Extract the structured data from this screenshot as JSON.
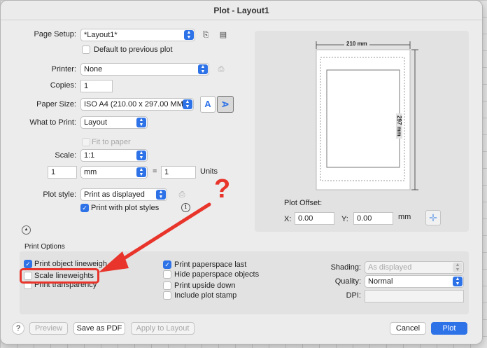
{
  "window": {
    "title": "Plot - Layout1"
  },
  "page_setup": {
    "label": "Page Setup:",
    "value": "*Layout1*",
    "default_checkbox_label": "Default to previous plot",
    "default_checked": false
  },
  "printer": {
    "label": "Printer:",
    "value": "None"
  },
  "copies": {
    "label": "Copies:",
    "value": "1"
  },
  "paper_size": {
    "label": "Paper Size:",
    "value": "ISO A4 (210.00 x 297.00 MM)",
    "portrait_glyph": "A",
    "landscape_glyph": "A"
  },
  "what_to_print": {
    "label": "What to Print:",
    "value": "Layout"
  },
  "fit_to_paper": {
    "label": "Fit to paper",
    "checked": false,
    "enabled": false
  },
  "scale": {
    "label": "Scale:",
    "value": "1:1"
  },
  "units_row": {
    "left": "1",
    "unit": "mm",
    "equals": "=",
    "right": "1",
    "units_label": "Units"
  },
  "plot_style": {
    "label": "Plot style:",
    "value": "Print as displayed",
    "with_styles_label": "Print with plot styles",
    "with_styles_checked": true
  },
  "preview": {
    "width_label": "210 mm",
    "height_label": "297 mm"
  },
  "plot_offset": {
    "title": "Plot Offset:",
    "x_label": "X:",
    "x_value": "0.00",
    "y_label": "Y:",
    "y_value": "0.00",
    "unit": "mm"
  },
  "print_options": {
    "title": "Print Options",
    "left": [
      {
        "label": "Print object lineweights",
        "checked": true
      },
      {
        "label": "Scale lineweights",
        "checked": false
      },
      {
        "label": "Print transparency",
        "checked": false
      }
    ],
    "middle": [
      {
        "label": "Print paperspace last",
        "checked": true
      },
      {
        "label": "Hide paperspace objects",
        "checked": false
      },
      {
        "label": "Print upside down",
        "checked": false
      },
      {
        "label": "Include plot stamp",
        "checked": false
      }
    ],
    "shading_label": "Shading:",
    "shading_value": "As displayed",
    "quality_label": "Quality:",
    "quality_value": "Normal",
    "dpi_label": "DPI:",
    "dpi_value": ""
  },
  "annotation": {
    "question_mark": "?",
    "color": "#e8342a"
  },
  "footer": {
    "help": "?",
    "preview": "Preview",
    "save_pdf": "Save as PDF",
    "apply_layout": "Apply to Layout",
    "cancel": "Cancel",
    "plot": "Plot"
  },
  "colors": {
    "accent": "#2e72e8",
    "annotation": "#e8342a"
  }
}
